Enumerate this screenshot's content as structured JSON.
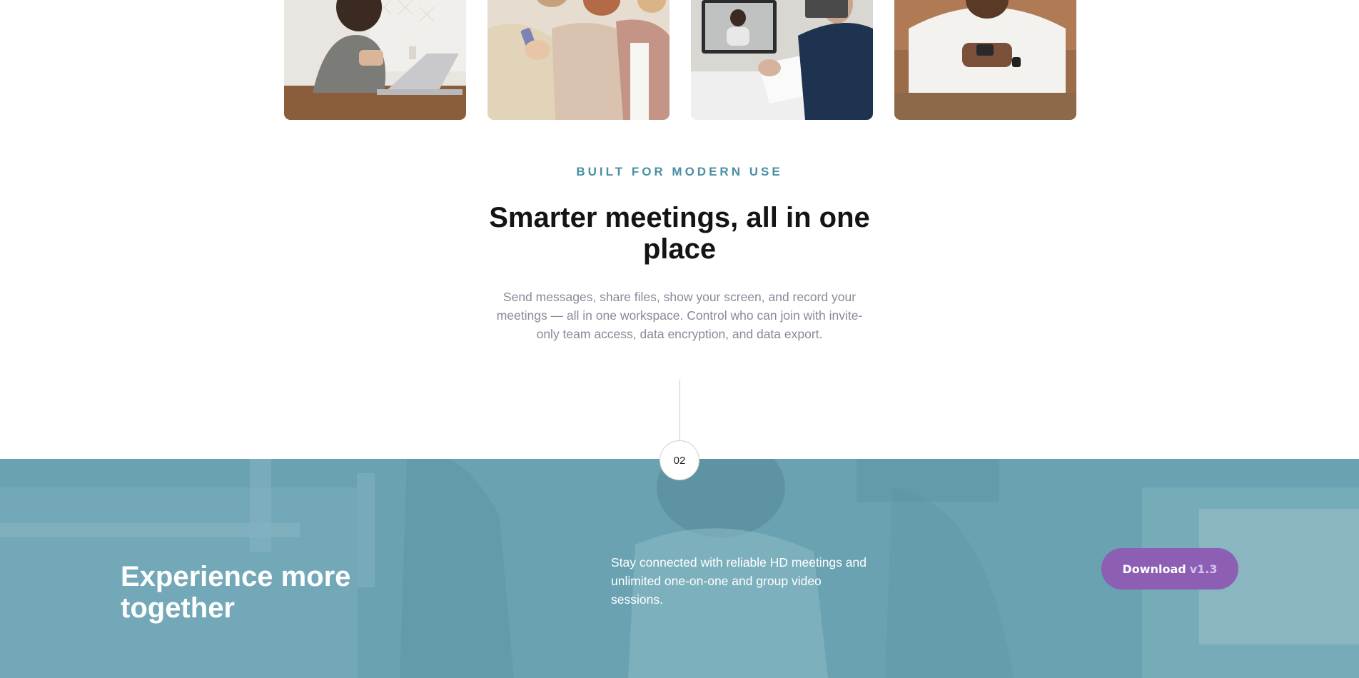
{
  "photos": {
    "items": [
      {
        "icon": "woman-with-laptop-photo"
      },
      {
        "icon": "women-looking-at-phone-photo"
      },
      {
        "icon": "man-on-video-call-photo"
      },
      {
        "icon": "man-using-phone-photo"
      }
    ]
  },
  "intro": {
    "eyebrow": "BUILT FOR MODERN USE",
    "headline": "Smarter meetings, all in one place",
    "body": "Send messages, share files, show your screen, and record your meetings — all in one workspace. Control who can join with invite-only team access, data encryption, and data export."
  },
  "step": {
    "number": "02"
  },
  "band": {
    "title": "Experience more together",
    "description": "Stay connected with reliable HD meetings and unlimited one-on-one and group video sessions.",
    "button_label": "Download",
    "button_version": "v1.3",
    "background_icon": "woman-with-headphones-photo"
  },
  "colors": {
    "accent_teal": "#4a8fa3",
    "band_overlay": "#6aa2b2",
    "button_purple": "#8c5fb4"
  }
}
